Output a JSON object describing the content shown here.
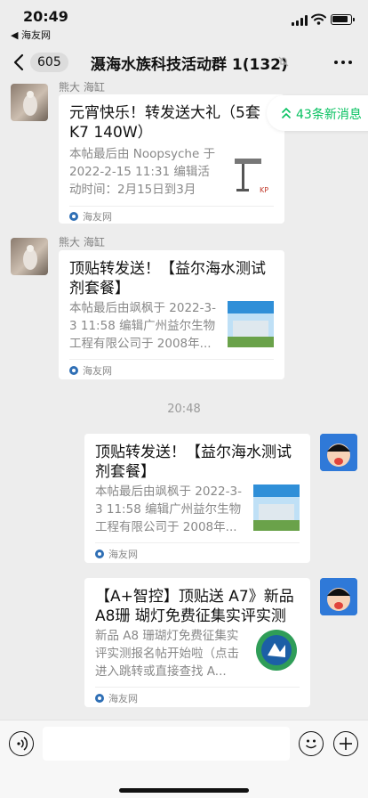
{
  "status_bar": {
    "time": "20:49",
    "back_app": "◀ 海友网"
  },
  "nav": {
    "unread_count": "605",
    "title": "滠海水族科技活动群 1(132)",
    "mute_icon": "mute-bell-icon",
    "more_icon": "more-dots-icon"
  },
  "new_messages": {
    "label": "43条新消息"
  },
  "messages": [
    {
      "sender": "熊大 海缸",
      "title": "元宵快乐！转发送大礼（5套 K7  140W）",
      "desc": "本帖最后由 Noopsyche 于 2022-2-15 11:31 编辑活动时间：2月15日到3月14...",
      "source": "海友网"
    },
    {
      "sender": "熊大 海缸",
      "title": "顶贴转发送！【益尔海水测试剂套餐】",
      "desc": "本帖最后由飒枫于 2022-3-3 11:58 编辑广州益尔生物工程有限公司于 2008年...",
      "source": "海友网"
    },
    {
      "title": "顶贴转发送！【益尔海水测试剂套餐】",
      "desc": "本帖最后由飒枫于 2022-3-3 11:58 编辑广州益尔生物工程有限公司于 2008年...",
      "source": "海友网"
    },
    {
      "title": "【A+智控】顶贴送 A7》新品 A8珊 瑚灯免费征集实评实测",
      "desc": "新品 A8 珊瑚灯免费征集实评实测报名帖开始啦（点击进入跳转或直接查找 A...",
      "source": "海友网"
    }
  ],
  "time_divider": "20:48",
  "thumb_texts": {
    "kp_logo": "KP",
    "yier_banner": "益尔生物 海水测试套餐"
  },
  "colors": {
    "accent_green": "#07c160",
    "bubble": "#ffffff",
    "background": "#ededed"
  }
}
